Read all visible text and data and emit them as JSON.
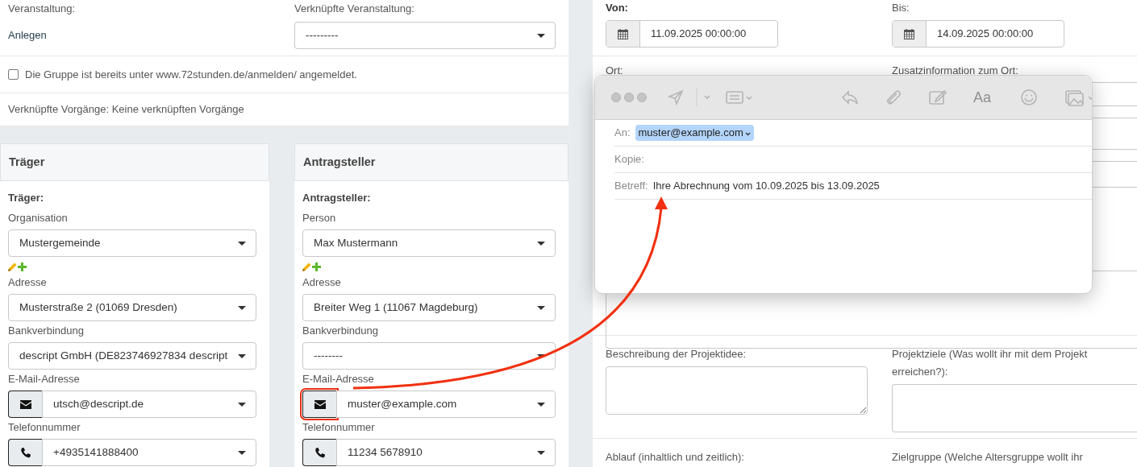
{
  "event_section": {
    "event_label": "Veranstaltung:",
    "event_value": "Anlegen",
    "linked_event_label": "Verknüpfte Veranstaltung:",
    "linked_event_select": "---------",
    "registered_checkbox": {
      "label": "Die Gruppe ist bereits unter www.72stunden.de/anmelden/ angemeldet.",
      "checked": false
    },
    "linked_processes": "Verknüpfte Vorgänge: Keine verknüpften Vorgänge"
  },
  "cards": [
    {
      "title": "Träger",
      "subtitle": "Träger:",
      "fields": [
        {
          "kind": "select",
          "label": "Organisation",
          "value": "Mustergemeinde"
        },
        {
          "kind": "edit_icons"
        },
        {
          "kind": "select",
          "label": "Adresse",
          "value": "Musterstraße 2 (01069 Dresden)"
        },
        {
          "kind": "select",
          "label": "Bankverbindung",
          "value": "descript GmbH (DE823746927834 descript"
        },
        {
          "kind": "mail_select",
          "label": "E-Mail-Adresse",
          "value": "utsch@descript.de",
          "highlighted": false
        },
        {
          "kind": "phone_select",
          "label": "Telefonnummer",
          "value": "+4935141888400",
          "highlighted": false
        }
      ]
    },
    {
      "title": "Antragsteller",
      "subtitle": "Antragsteller:",
      "fields": [
        {
          "kind": "select",
          "label": "Person",
          "value": "Max Mustermann"
        },
        {
          "kind": "edit_icons"
        },
        {
          "kind": "select",
          "label": "Adresse",
          "value": "Breiter Weg 1 (11067 Magdeburg)"
        },
        {
          "kind": "select",
          "label": "Bankverbindung",
          "value": "--------"
        },
        {
          "kind": "mail_select",
          "label": "E-Mail-Adresse",
          "value": "muster@example.com",
          "highlighted": true
        },
        {
          "kind": "phone_select",
          "label": "Telefonnummer",
          "value": "11234 5678910",
          "highlighted": false
        }
      ]
    }
  ],
  "dates": [
    {
      "label": "Von:",
      "value": "11.09.2025 00:00:00",
      "emphasized": true
    },
    {
      "label": "Bis:",
      "value": "14.09.2025 00:00:00",
      "emphasized": false
    }
  ],
  "location_labels": [
    "Ort:",
    "Zusatzinformation zum Ort:"
  ],
  "text_areas": [
    {
      "label": "Beschreibung der Projektidee:"
    },
    {
      "label": "Projektziele (Was wollt ihr mit dem Projekt erreichen?):"
    },
    {
      "label": "Ablauf (inhaltlich und zeitlich):"
    },
    {
      "label": "Zielgruppe (Welche Altersgruppe wollt ihr"
    }
  ],
  "mail_window": {
    "to_label": "An:",
    "to_value": "muster@example.com",
    "cc_label": "Kopie:",
    "subject_label": "Betreff:",
    "subject": "Ihre Abrechnung vom 10.09.2025 bis 13.09.2025",
    "format_label": "Aa"
  }
}
